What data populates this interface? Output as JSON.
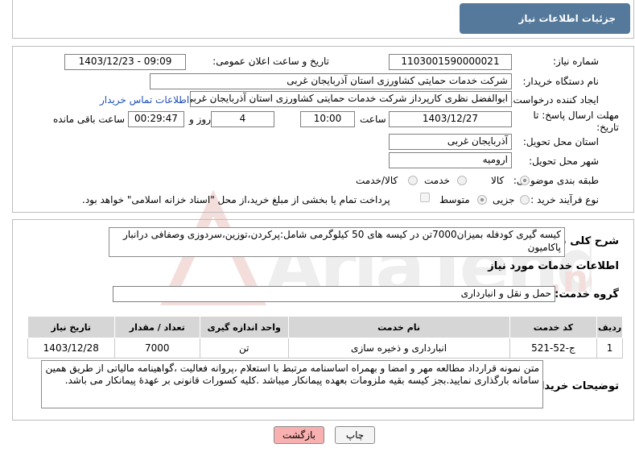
{
  "title": "جزئیات اطلاعات نیاز",
  "fields": {
    "need_number_label": "شماره نیاز:",
    "need_number": "1103001590000021",
    "announce_label": "تاریخ و ساعت اعلان عمومی:",
    "announce_value": "1403/12/23 - 09:09",
    "buyer_org_label": "نام دستگاه خریدار:",
    "buyer_org": "شرکت خدمات حمایتی کشاورزی استان آذربایجان غربی",
    "requester_label": "ایجاد کننده درخواست:",
    "requester": "ابوالفضل نظری کارپرداز شرکت خدمات حمایتی کشاورزی استان آذربایجان غربی",
    "contact_link": "اطلاعات تماس خریدار",
    "deadline_label": "مهلت ارسال پاسخ: تا تاریخ:",
    "deadline_date": "1403/12/27",
    "time_label": "ساعت",
    "deadline_time": "10:00",
    "days_value": "4",
    "days_label": "روز و",
    "remaining_value": "00:29:47",
    "remaining_label": "ساعت باقی مانده",
    "province_label": "استان محل تحویل:",
    "province": "آذربایجان غربی",
    "city_label": "شهر محل تحویل:",
    "city": "ارومیه",
    "category_label": "طبقه بندی موضوعی:",
    "category_options": [
      "کالا",
      "خدمت",
      "کالا/خدمت"
    ],
    "process_label": "نوع فرآیند خرید :",
    "process_options": [
      "جزیی",
      "متوسط"
    ],
    "payment_note": "پرداخت تمام یا بخشی از مبلغ خرید،از محل \"اسناد خزانه اسلامی\" خواهد بود."
  },
  "summary": {
    "label": "شرح کلی نیاز:",
    "text": "کیسه گیری کودفله بمیزان7000تن در کیسه های 50 کیلوگرمی شامل:پرکردن،توزین،سردوزی وصفافی درانبار پاکامیون"
  },
  "services": {
    "heading": "اطلاعات خدمات مورد نیاز",
    "group_label": "گروه خدمت:",
    "group_value": "حمل و نقل و انبارداری",
    "columns": [
      "ردیف",
      "کد خدمت",
      "نام خدمت",
      "واحد اندازه گیری",
      "تعداد / مقدار",
      "تاریخ نیاز"
    ],
    "rows": [
      [
        "1",
        "ج-52-521",
        "انبارداری و ذخیره سازی",
        "تن",
        "7000",
        "1403/12/28"
      ]
    ]
  },
  "buyer_notes": {
    "label": "توضیحات خریدار:",
    "text": "متن نمونه قرارداد مطالعه مهر و امضا و بهمراه اساسنامه مرتبط با استعلام ،پروانه فعالیت ،گواهینامه مالیاتی از طریق همین سامانه بارگذاری نمایید.بجز کیسه بقیه ملزومات بعهده پیمانکار میباشد .کلیه کسورات قانونی بر عهدهٔ پیمانکار می باشد."
  },
  "buttons": {
    "print": "چاپ",
    "back": "بازگشت"
  },
  "colors": {
    "header": "#54799b",
    "link": "#1f4fb4",
    "back_button": "#f9b0b0"
  }
}
